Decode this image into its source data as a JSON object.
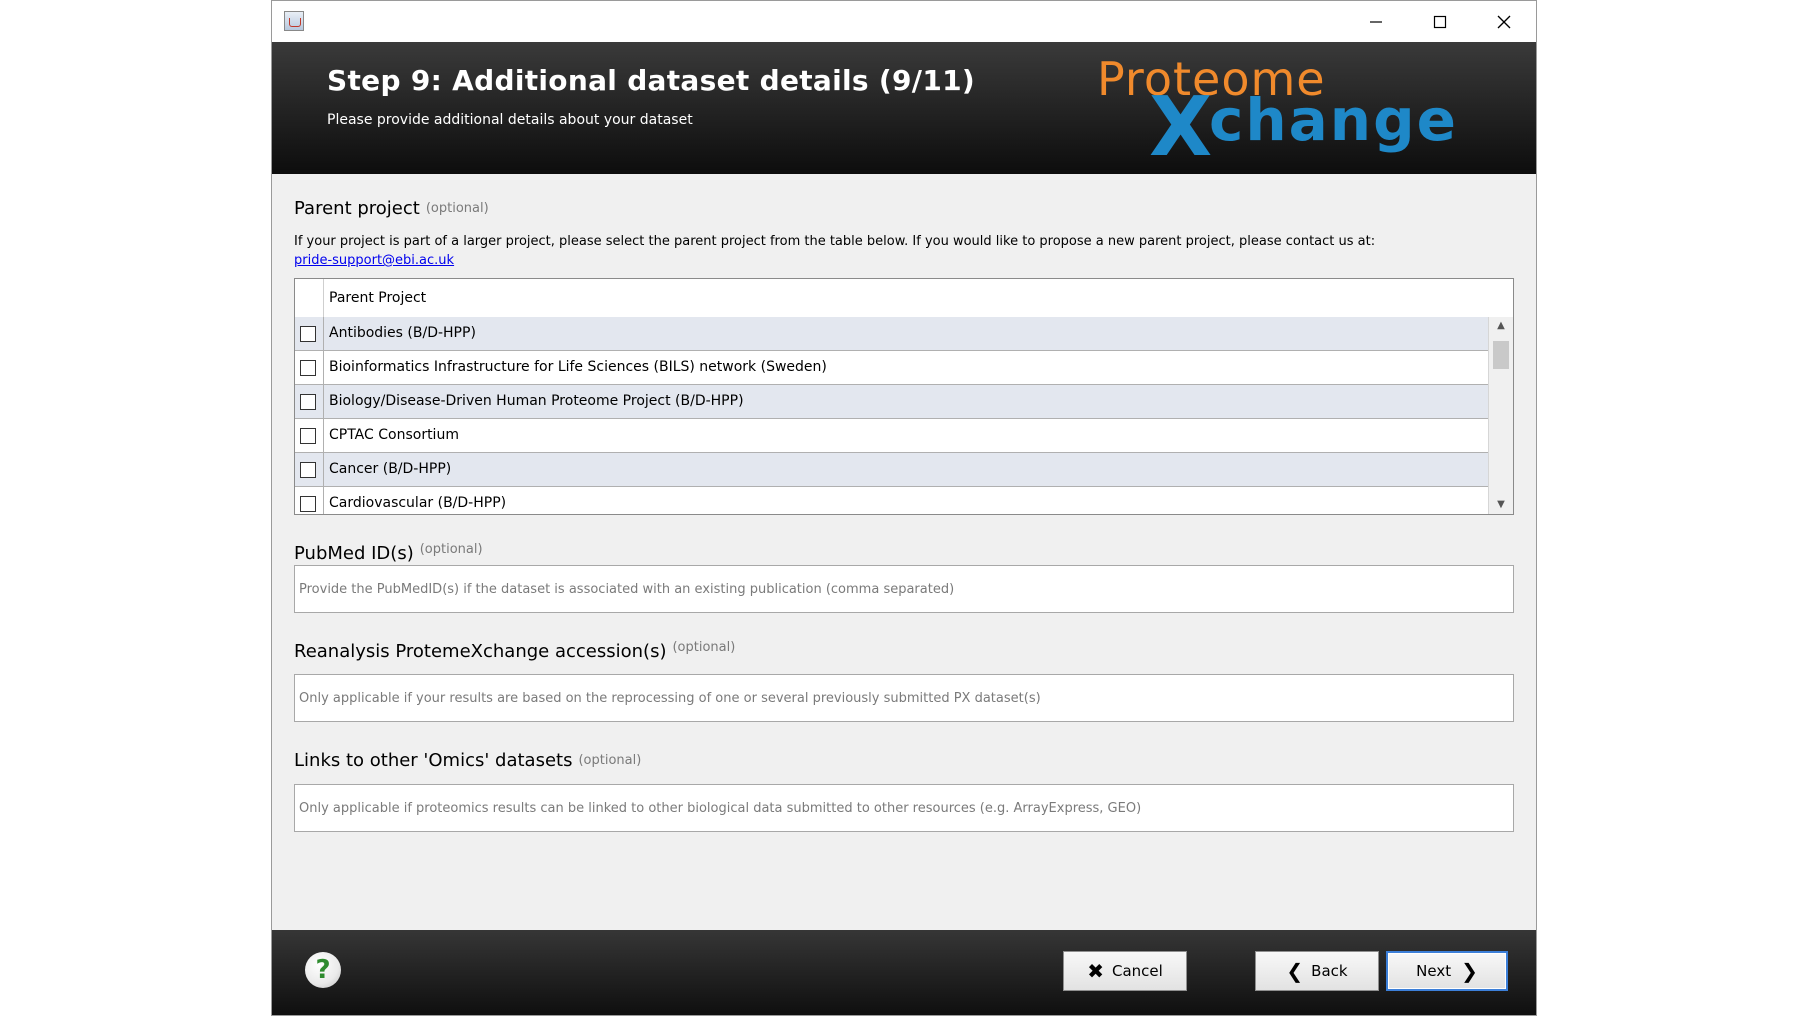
{
  "header": {
    "title": "Step 9: Additional dataset details (9/11)",
    "subtitle": "Please provide additional details about your dataset",
    "logo_top": "Proteome",
    "logo_x": "X",
    "logo_bottom": "change"
  },
  "parent_project": {
    "title": "Parent project",
    "optional": "(optional)",
    "description": "If your project is part of a larger project, please select the parent project from the table below. If you would like to propose a new parent project, please contact us at:",
    "email": "pride-support@ebi.ac.uk",
    "column_header": "Parent Project",
    "rows": [
      {
        "label": "Antibodies (B/D-HPP)",
        "checked": false
      },
      {
        "label": "Bioinformatics Infrastructure for Life Sciences (BILS) network (Sweden)",
        "checked": false
      },
      {
        "label": "Biology/Disease-Driven Human Proteome Project (B/D-HPP)",
        "checked": false
      },
      {
        "label": "CPTAC Consortium",
        "checked": false
      },
      {
        "label": "Cancer (B/D-HPP)",
        "checked": false
      },
      {
        "label": "Cardiovascular (B/D-HPP)",
        "checked": false
      }
    ]
  },
  "pubmed": {
    "title": "PubMed ID(s)",
    "optional": "(optional)",
    "placeholder": "Provide the PubMedID(s) if the dataset is associated with an existing publication (comma separated)"
  },
  "reanalysis": {
    "title": "Reanalysis ProtemeXchange accession(s)",
    "optional": "(optional)",
    "placeholder": "Only applicable if your results are based on the reprocessing of one or several previously submitted PX dataset(s)"
  },
  "omics": {
    "title": "Links to other 'Omics' datasets",
    "optional": "(optional)",
    "placeholder": "Only applicable if proteomics results can be linked to other biological data submitted to other resources (e.g. ArrayExpress, GEO)"
  },
  "footer": {
    "help_glyph": "?",
    "cancel": "Cancel",
    "back": "Back",
    "next": "Next"
  },
  "colors": {
    "header_bg": "#1a1a1a",
    "logo_orange": "#f08a2c",
    "logo_blue": "#1e88c8",
    "row_alt": "#e3e7ef",
    "next_focus": "#3c7fd8"
  }
}
